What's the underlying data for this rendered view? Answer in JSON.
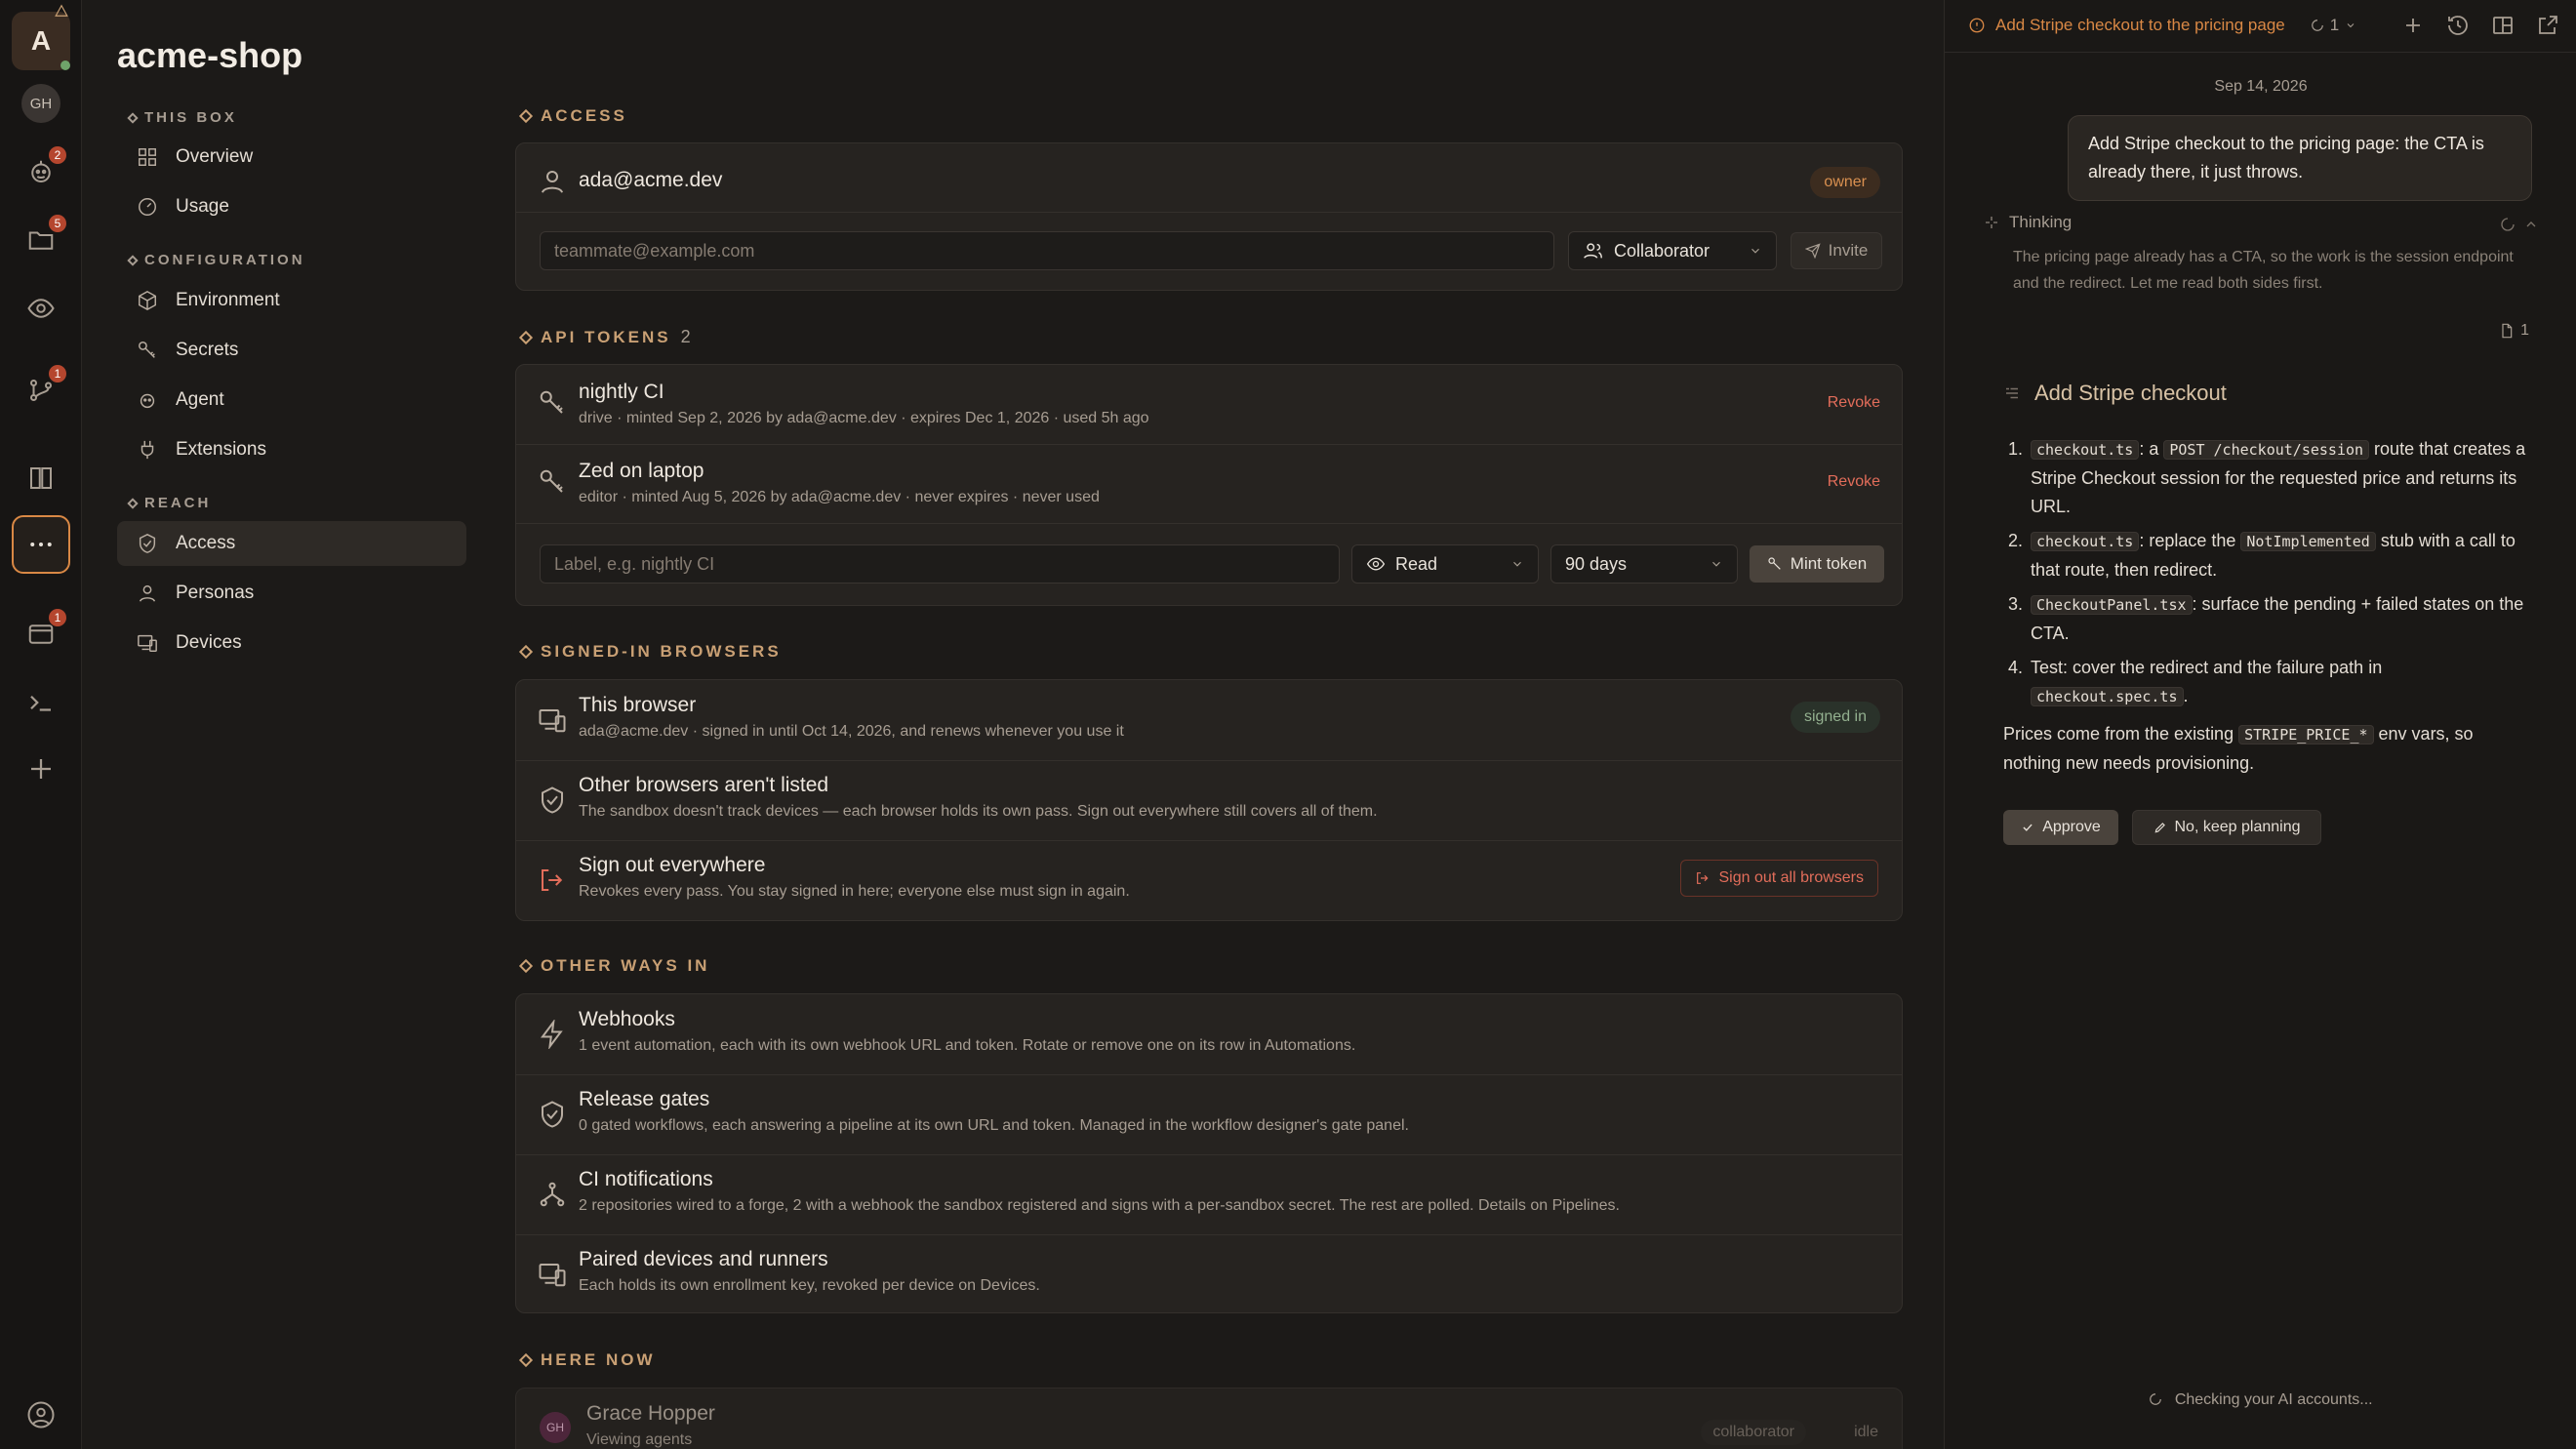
{
  "rail": {
    "workspace_initial": "A",
    "gh_initials": "GH",
    "badges": {
      "agents": "2",
      "files": "5",
      "pipelines": "1",
      "deploys": "1"
    },
    "user_icon": "user-icon"
  },
  "sidebar": {
    "title": "acme-shop",
    "sections": {
      "this_box": "THIS BOX",
      "configuration": "CONFIGURATION",
      "reach": "REACH"
    },
    "items": {
      "overview": "Overview",
      "usage": "Usage",
      "environment": "Environment",
      "secrets": "Secrets",
      "agent": "Agent",
      "extensions": "Extensions",
      "access": "Access",
      "personas": "Personas",
      "devices": "Devices"
    }
  },
  "access": {
    "label": "ACCESS",
    "user_email": "ada@acme.dev",
    "owner_badge": "owner",
    "invite_placeholder": "teammate@example.com",
    "role_select": "Collaborator",
    "invite_button": "Invite"
  },
  "tokens": {
    "label": "API TOKENS",
    "count": "2",
    "rows": [
      {
        "name": "nightly CI",
        "meta": "drive · minted Sep 2, 2026 by ada@acme.dev · expires Dec 1, 2026 · used 5h ago",
        "action": "Revoke"
      },
      {
        "name": "Zed on laptop",
        "meta": "editor · minted Aug 5, 2026 by ada@acme.dev · never expires · never used",
        "action": "Revoke"
      }
    ],
    "label_placeholder": "Label, e.g. nightly CI",
    "scope_select": "Read",
    "expiry_select": "90 days",
    "mint_button": "Mint token"
  },
  "browsers": {
    "label": "SIGNED-IN BROWSERS",
    "this_title": "This browser",
    "this_meta": "ada@acme.dev · signed in until Oct 14, 2026, and renews whenever you use it",
    "this_badge": "signed in",
    "other_title": "Other browsers aren't listed",
    "other_meta": "The sandbox doesn't track devices — each browser holds its own pass. Sign out everywhere still covers all of them.",
    "signout_title": "Sign out everywhere",
    "signout_meta": "Revokes every pass. You stay signed in here; everyone else must sign in again.",
    "signout_button": "Sign out all browsers"
  },
  "other_ways": {
    "label": "OTHER WAYS IN",
    "rows": [
      {
        "title": "Webhooks",
        "meta": "1 event automation, each with its own webhook URL and token. Rotate or remove one on its row in Automations."
      },
      {
        "title": "Release gates",
        "meta": "0 gated workflows, each answering a pipeline at its own URL and token. Managed in the workflow designer's gate panel."
      },
      {
        "title": "CI notifications",
        "meta": "2 repositories wired to a forge, 2 with a webhook the sandbox registered and signs with a per-sandbox secret. The rest are polled. Details on Pipelines."
      },
      {
        "title": "Paired devices and runners",
        "meta": "Each holds its own enrollment key, revoked per device on Devices."
      }
    ]
  },
  "here_now": {
    "label": "HERE NOW",
    "initials": "GH",
    "name": "Grace Hopper",
    "activity": "Viewing agents",
    "role": "collaborator",
    "status": "idle"
  },
  "panel": {
    "tab_title": "Add Stripe checkout to the pricing page",
    "tab_count": "1",
    "date": "Sep 14, 2026",
    "user_message": "Add Stripe checkout to the pricing page: the CTA is already there, it just throws.",
    "thinking_label": "Thinking",
    "thinking_text": "The pricing page already has a CTA, so the work is the session endpoint and the redirect. Let me read both sides first.",
    "files_count": "1",
    "plan_title": "Add Stripe checkout",
    "plan": [
      {
        "n": "1.",
        "code": "checkout.ts",
        "text_a": ": a ",
        "code2": "POST /checkout/session",
        "text_b": " route that creates a Stripe Checkout session for the requested price and returns its URL."
      },
      {
        "n": "2.",
        "code": "checkout.ts",
        "text_a": ": replace the ",
        "code2": "NotImplemented",
        "text_b": " stub with a call to that route, then redirect."
      },
      {
        "n": "3.",
        "code": "CheckoutPanel.tsx",
        "text_a": ": surface the pending + failed states on the CTA.",
        "code2": "",
        "text_b": ""
      },
      {
        "n": "4.",
        "code": "",
        "text_a": "Test: cover the redirect and the failure path in ",
        "code2": "checkout.spec.ts",
        "text_b": "."
      }
    ],
    "note_a": "Prices come from the existing ",
    "note_code": "STRIPE_PRICE_*",
    "note_b": " env vars, so nothing new needs provisioning.",
    "approve_button": "Approve",
    "keep_planning_button": "No, keep planning",
    "status": "Checking your AI accounts..."
  },
  "colors": {
    "accent": "#d98845",
    "danger": "#e26d5a",
    "section": "#c9a074"
  }
}
